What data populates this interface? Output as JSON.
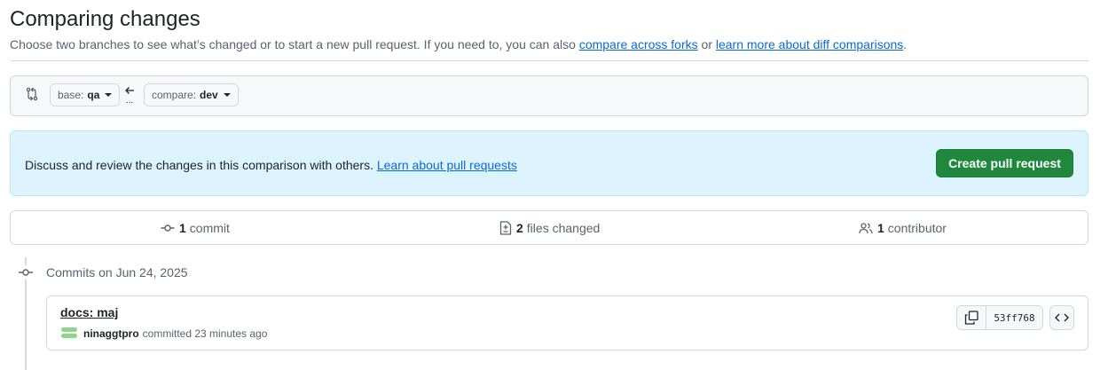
{
  "header": {
    "title": "Comparing changes",
    "subtitle_text": "Choose two branches to see what’s changed or to start a new pull request. If you need to, you can also ",
    "link_forks": "compare across forks",
    "subtitle_or": " or ",
    "link_diff": "learn more about diff comparisons",
    "subtitle_end": "."
  },
  "range": {
    "base_prefix": "base:",
    "base_branch": "qa",
    "compare_prefix": "compare:",
    "compare_branch": "dev",
    "dots": "..."
  },
  "flash": {
    "text": "Discuss and review the changes in this comparison with others. ",
    "link": "Learn about pull requests",
    "button": "Create pull request"
  },
  "summary": {
    "commits_count": "1",
    "commits_label": "commit",
    "files_count": "2",
    "files_label": "files changed",
    "contributors_count": "1",
    "contributors_label": "contributor"
  },
  "timeline": {
    "date_label": "Commits on Jun 24, 2025"
  },
  "commit": {
    "message": "docs: maj",
    "author": "ninaggtpro",
    "meta": "committed 23 minutes ago",
    "sha": "53ff768"
  },
  "colors": {
    "accent_link": "#0969da",
    "primary_button": "#1f883d",
    "flash_bg": "#ddf4ff"
  }
}
